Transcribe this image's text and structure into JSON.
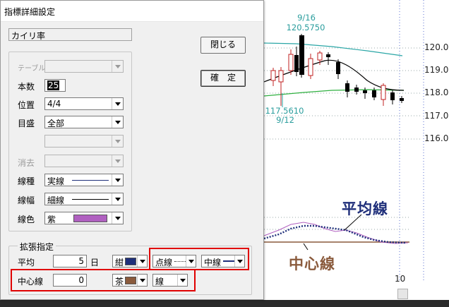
{
  "dialog": {
    "title": "指標詳細設定",
    "indicator_name": "カイリ率",
    "close_button": "閉じる",
    "ok_button": "確　定",
    "rows": {
      "table_label": "テーブル",
      "count_label": "本数",
      "count_value": "25",
      "position_label": "位置",
      "position_value": "4/4",
      "scale_label": "目盛",
      "scale_value": "全部",
      "erase_label": "消去",
      "line_type_label": "線種",
      "line_type_value": "実線",
      "line_width_label": "線幅",
      "line_width_value": "細線",
      "line_color_label": "線色",
      "line_color_value": "紫",
      "line_color_hex": "#b060c0"
    },
    "extended": {
      "group_title": "拡張指定",
      "avg_label": "平均",
      "avg_value": "5",
      "avg_unit": "日",
      "avg_color_name": "紺",
      "avg_color_hex": "#1f2f7a",
      "avg_line_type": "点線",
      "avg_line_width": "中線",
      "center_label": "中心線",
      "center_value": "0",
      "center_color_name": "茶",
      "center_color_hex": "#8a5a3c",
      "center_line_type": "線"
    }
  },
  "chart": {
    "price_labels": [
      "120.0",
      "119.0",
      "118.0",
      "117.0",
      "116.0"
    ],
    "high_date": "9/16",
    "high_value": "120.5750",
    "low_value": "117.5610",
    "low_date": "9/12",
    "callout_avg": "平均線",
    "callout_avg_color": "#1f2f7a",
    "callout_center": "中心線",
    "callout_center_color": "#8a5a3c",
    "x_tick": "10"
  }
}
